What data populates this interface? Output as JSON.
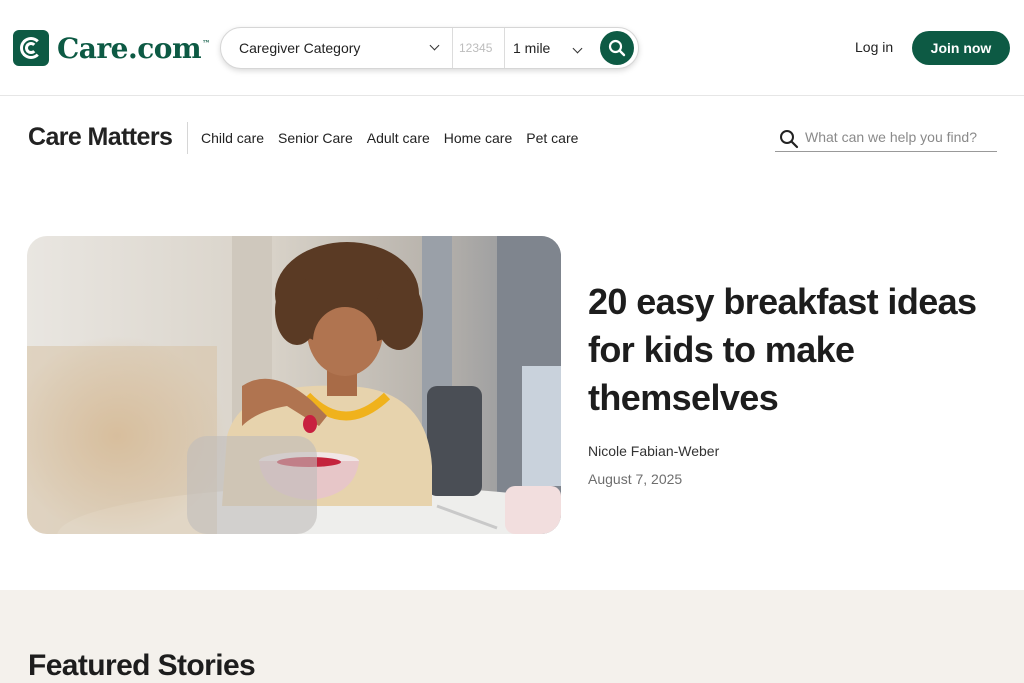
{
  "header": {
    "logo_text": "Care.com",
    "logo_tm": "™",
    "search": {
      "category_value": "Caregiver Category",
      "zip_placeholder": "12345",
      "distance_value": "1 mile"
    },
    "login_label": "Log in",
    "join_label": "Join now"
  },
  "subnav": {
    "brand": "Care Matters",
    "links": [
      "Child care",
      "Senior Care",
      "Adult care",
      "Home care",
      "Pet care"
    ],
    "search_placeholder": "What can we help you find?"
  },
  "hero": {
    "title": "20 easy breakfast ideas for kids to make themselves",
    "author": "Nicole Fabian-Weber",
    "date": "August 7, 2025"
  },
  "featured": {
    "heading": "Featured Stories"
  },
  "colors": {
    "brand_green": "#0d5a44",
    "featured_bg": "#f4f1ec"
  },
  "icons": [
    "care-logo-icon",
    "chevron-down-icon",
    "search-icon"
  ]
}
